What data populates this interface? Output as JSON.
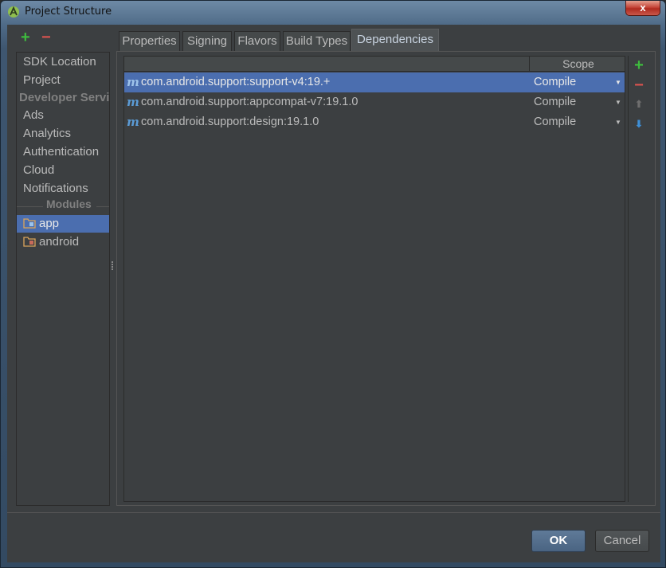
{
  "window": {
    "title": "Project Structure",
    "close_label": "x"
  },
  "toolbar": {
    "add_label": "+",
    "remove_label": "−"
  },
  "sidebar": {
    "items": [
      {
        "label": "SDK Location"
      },
      {
        "label": "Project"
      }
    ],
    "services_header": "Developer Services",
    "services": [
      {
        "label": "Ads"
      },
      {
        "label": "Analytics"
      },
      {
        "label": "Authentication"
      },
      {
        "label": "Cloud"
      },
      {
        "label": "Notifications"
      }
    ],
    "modules_header": "Modules",
    "modules": [
      {
        "label": "app",
        "selected": true
      },
      {
        "label": "android",
        "selected": false
      }
    ]
  },
  "tabs": [
    {
      "label": "Properties"
    },
    {
      "label": "Signing"
    },
    {
      "label": "Flavors"
    },
    {
      "label": "Build Types"
    },
    {
      "label": "Dependencies",
      "active": true
    }
  ],
  "dependencies": {
    "columns": {
      "dependency": "",
      "scope": "Scope"
    },
    "rows": [
      {
        "icon": "m",
        "name": "com.android.support:support-v4:19.+",
        "scope": "Compile",
        "selected": true
      },
      {
        "icon": "m",
        "name": "com.android.support:appcompat-v7:19.1.0",
        "scope": "Compile",
        "selected": false
      },
      {
        "icon": "m",
        "name": "com.android.support:design:19.1.0",
        "scope": "Compile",
        "selected": false
      }
    ],
    "tools": {
      "add": "+",
      "remove": "−",
      "up": "⬆",
      "down": "⬇"
    }
  },
  "buttons": {
    "ok": "OK",
    "cancel": "Cancel"
  },
  "colors": {
    "selection": "#4b6eaf",
    "add": "#3ebb3e",
    "remove": "#d9534f",
    "background": "#3c3f41"
  }
}
